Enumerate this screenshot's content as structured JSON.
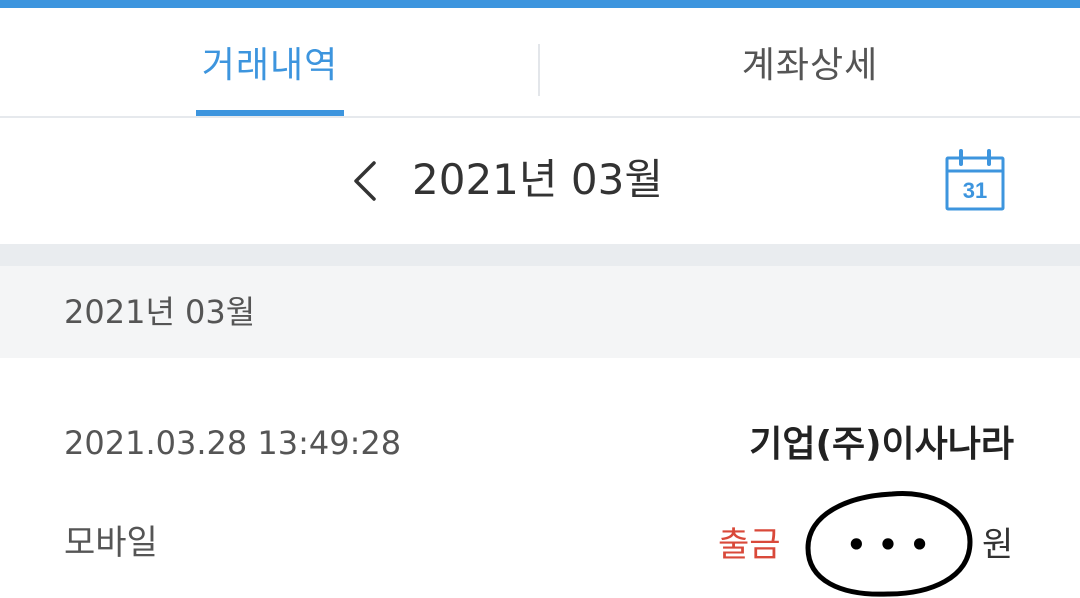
{
  "tabs": {
    "transactions_label": "거래내역",
    "account_details_label": "계좌상세"
  },
  "month_nav": {
    "prev_icon": "chevron-left-icon",
    "current_month": "2021년 03월",
    "calendar_icon": "calendar-icon",
    "calendar_day": "31"
  },
  "list": {
    "month_header": "2021년 03월",
    "transactions": [
      {
        "datetime": "2021.03.28 13:49:28",
        "merchant": "기업(주)이사나라",
        "channel": "모바일",
        "type": "출금",
        "amount": "• • •",
        "unit": "원"
      }
    ]
  },
  "colors": {
    "accent": "#3d95de",
    "withdrawal": "#d9493a",
    "section_bg": "#f4f5f6"
  }
}
